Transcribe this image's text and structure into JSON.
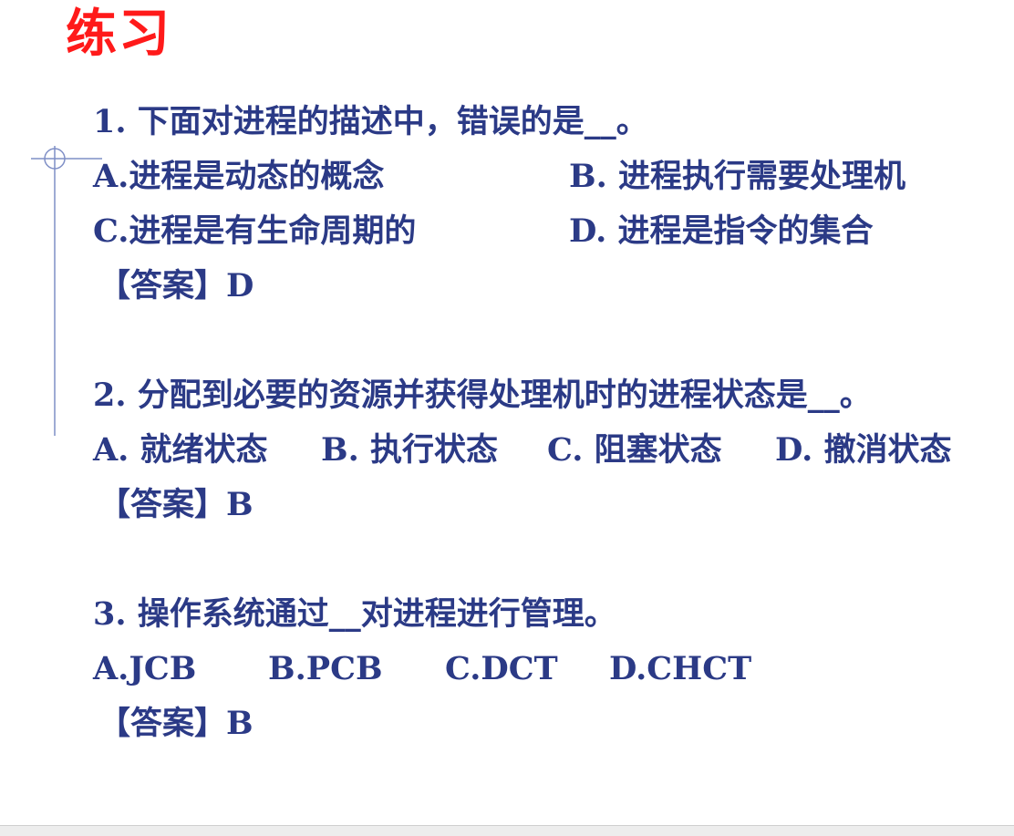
{
  "title": "练习",
  "questions": [
    {
      "stem": "1. 下面对进程的描述中，错误的是__。",
      "options": [
        "A.进程是动态的概念",
        "B. 进程执行需要处理机",
        "C.进程是有生命周期的",
        "D. 进程是指令的集合"
      ],
      "answer": "【答案】D"
    },
    {
      "stem": "2. 分配到必要的资源并获得处理机时的进程状态是__。",
      "options": [
        "A. 就绪状态",
        "B. 执行状态",
        "C. 阻塞状态",
        "D. 撤消状态"
      ],
      "answer": "【答案】B"
    },
    {
      "stem": "3. 操作系统通过__对进程进行管理。",
      "options": [
        "A.JCB",
        "B.PCB",
        "C.DCT",
        "D.CHCT"
      ],
      "answer": "【答案】B"
    }
  ],
  "colors": {
    "title": "#ff1a1a",
    "text": "#2b3a86",
    "decoration": "#7f8fc6"
  }
}
